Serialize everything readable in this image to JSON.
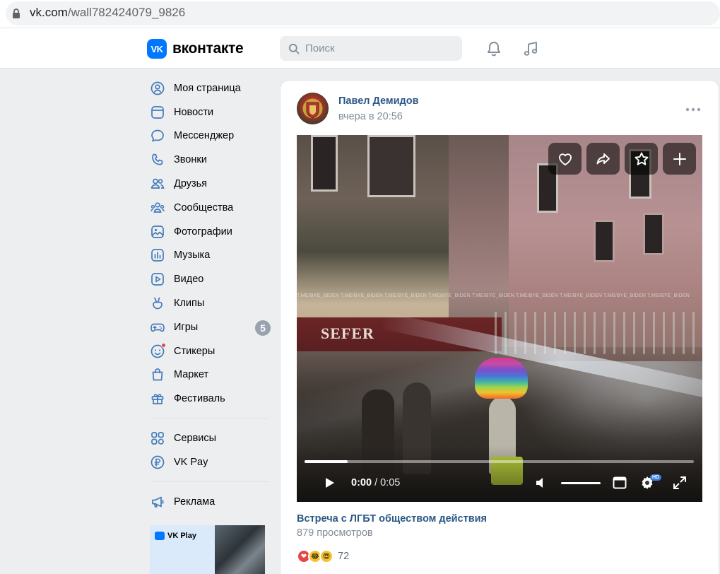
{
  "browser": {
    "url_host": "vk.com",
    "url_path": "/wall782424079_9826"
  },
  "header": {
    "logo_mark": "VK",
    "logo_text": "вконтакте",
    "search_placeholder": "Поиск"
  },
  "sidebar": {
    "items": [
      {
        "label": "Моя страница",
        "icon": "user-circle-icon"
      },
      {
        "label": "Новости",
        "icon": "newsfeed-icon"
      },
      {
        "label": "Мессенджер",
        "icon": "message-icon"
      },
      {
        "label": "Звонки",
        "icon": "phone-icon"
      },
      {
        "label": "Друзья",
        "icon": "friends-icon"
      },
      {
        "label": "Сообщества",
        "icon": "communities-icon"
      },
      {
        "label": "Фотографии",
        "icon": "photo-icon"
      },
      {
        "label": "Музыка",
        "icon": "music-icon"
      },
      {
        "label": "Видео",
        "icon": "video-icon"
      },
      {
        "label": "Клипы",
        "icon": "clips-icon"
      },
      {
        "label": "Игры",
        "icon": "gamepad-icon",
        "badge": "5"
      },
      {
        "label": "Стикеры",
        "icon": "smile-icon"
      },
      {
        "label": "Маркет",
        "icon": "bag-icon"
      },
      {
        "label": "Фестиваль",
        "icon": "gift-icon"
      }
    ],
    "items2": [
      {
        "label": "Сервисы",
        "icon": "services-icon"
      },
      {
        "label": "VK Pay",
        "icon": "ruble-icon"
      }
    ],
    "items3": [
      {
        "label": "Реклама",
        "icon": "megaphone-icon"
      }
    ],
    "promo_text": "VK Play"
  },
  "post": {
    "author": "Павел Демидов",
    "time": "вчера в 20:56",
    "video": {
      "sign_text": "SEFER",
      "watermark": "T.ME/BYE_BIDEN T.ME/BYE_BIDEN T.ME/BYE_BIDEN T.ME/BYE_BIDEN T.ME/BYE_BIDEN T.ME/BYE_BIDEN T.ME/BYE_BIDEN T.ME/BYE_BIDEN T.ME/BYE_BIDEN",
      "current_time": "0:00",
      "duration": "/ 0:05",
      "progress_fraction": 0.11,
      "volume_fraction": 1.0,
      "hd_label": "HD"
    },
    "video_title": "Встреча с ЛГБТ обществом действия",
    "views": "879 просмотров",
    "reactions_count": "72"
  },
  "colors": {
    "accent": "#0077ff",
    "link": "#2a5885",
    "secondary_text": "#818c99",
    "badge": "#99a2ad"
  }
}
